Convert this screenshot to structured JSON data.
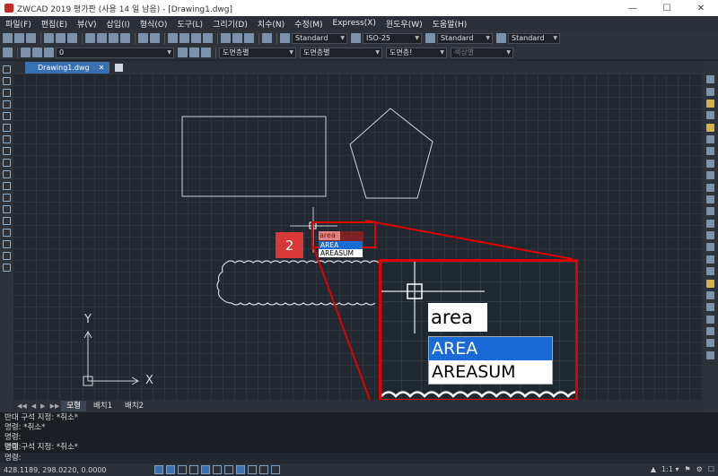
{
  "window": {
    "title": "ZWCAD 2019 평가판 (사용 14 일 남음) - [Drawing1.dwg]",
    "minimize_glyph": "—",
    "maximize_glyph": "☐",
    "close_glyph": "✕"
  },
  "menu": [
    "파일(F)",
    "편집(E)",
    "뷰(V)",
    "삽입(I)",
    "형식(O)",
    "도구(L)",
    "그리기(D)",
    "치수(N)",
    "수정(M)",
    "Express(X)",
    "윈도우(W)",
    "도움말(H)"
  ],
  "toolbar": {
    "text_style": "Standard",
    "dim_style": "ISO-25",
    "table_style": "Standard",
    "multileader_style": "Standard",
    "layer": "0",
    "color": "도면층별",
    "linetype": "도면층별",
    "lineweight": "도면층!",
    "plot_style": "색상별"
  },
  "document_tab": {
    "label": "Drawing1.dwg",
    "close_glyph": "✕",
    "dock_controls": "▫ ▫ ✕"
  },
  "canvas": {
    "ucs_y_label": "Y",
    "ucs_x_label": "X"
  },
  "autocomplete": {
    "typed": "area",
    "options": [
      "AREA",
      "AREASUM"
    ],
    "selected_index": 0
  },
  "step_badge": "2",
  "layout_tabs": {
    "nav": [
      "◀◀",
      "◀",
      "▶",
      "▶▶"
    ],
    "tabs": [
      "모형",
      "배치1",
      "배치2"
    ],
    "active_index": 0
  },
  "command_history": [
    "반대 구석 지정: *취소*",
    "명령: *취소*",
    "명령:",
    "명령:",
    "반대 구석 지정: *취소*"
  ],
  "command_prompt": "명령:",
  "status": {
    "coordinates": "428.1189, 298.0220, 0.0000",
    "annotation_scale": "1:1",
    "right_icons": [
      "▲",
      "1:1 ▾",
      "⚑",
      "⚙",
      "☐"
    ]
  },
  "colors": {
    "accent": "#3a6fb0",
    "highlight_red": "#e00000",
    "badge_red": "#d9383a",
    "selection_blue": "#1b6bd6",
    "canvas_bg": "#212830"
  }
}
